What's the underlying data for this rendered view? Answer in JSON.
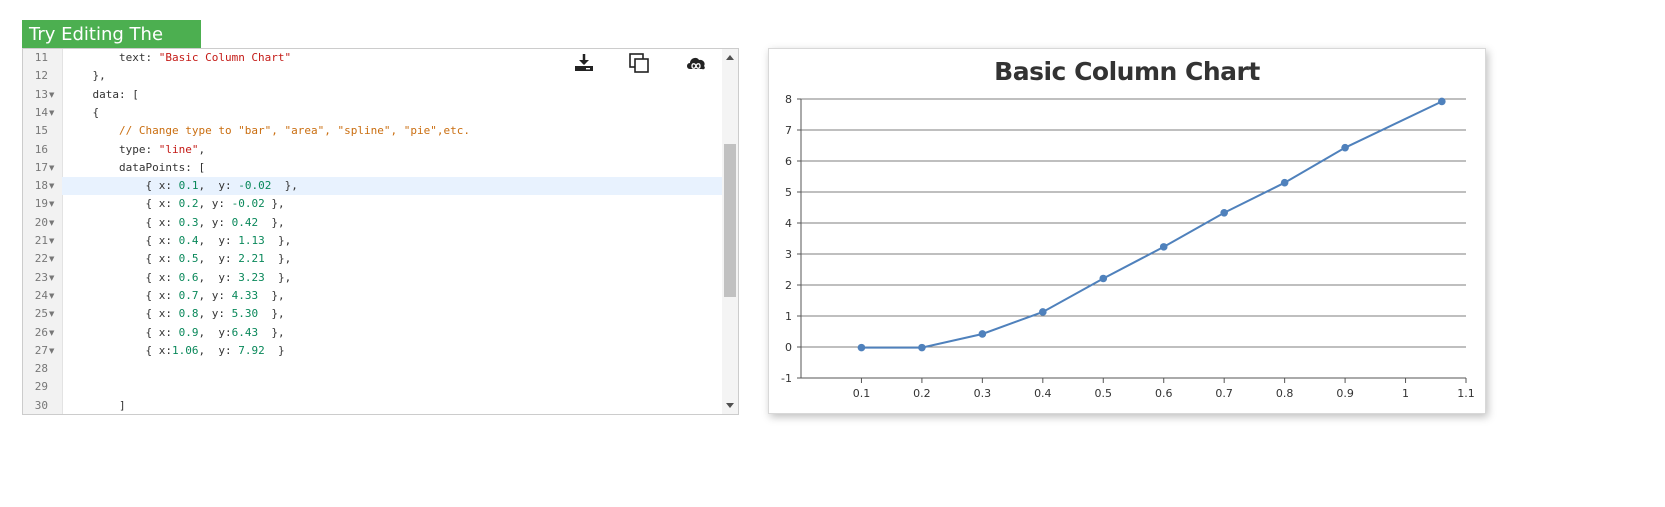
{
  "try_button": {
    "label": "Try Editing The Code"
  },
  "toolbar": {
    "icons": [
      "download-icon",
      "copy-icon",
      "cloud-infinity-icon"
    ]
  },
  "editor": {
    "lines": [
      {
        "num": "11",
        "fold": false,
        "active": false,
        "tokens": [
          {
            "t": "plain",
            "v": "        text: "
          },
          {
            "t": "str",
            "v": "\"Basic Column Chart\""
          }
        ]
      },
      {
        "num": "12",
        "fold": false,
        "active": false,
        "tokens": [
          {
            "t": "plain",
            "v": "    },"
          }
        ]
      },
      {
        "num": "13",
        "fold": true,
        "active": false,
        "tokens": [
          {
            "t": "plain",
            "v": "    data: ["
          }
        ]
      },
      {
        "num": "14",
        "fold": true,
        "active": false,
        "tokens": [
          {
            "t": "plain",
            "v": "    {"
          }
        ]
      },
      {
        "num": "15",
        "fold": false,
        "active": false,
        "tokens": [
          {
            "t": "com",
            "v": "        // Change type to \"bar\", \"area\", \"spline\", \"pie\",etc."
          }
        ]
      },
      {
        "num": "16",
        "fold": false,
        "active": false,
        "tokens": [
          {
            "t": "plain",
            "v": "        type: "
          },
          {
            "t": "str",
            "v": "\"line\""
          },
          {
            "t": "plain",
            "v": ","
          }
        ]
      },
      {
        "num": "17",
        "fold": true,
        "active": false,
        "tokens": [
          {
            "t": "plain",
            "v": "        dataPoints: ["
          }
        ]
      },
      {
        "num": "18",
        "fold": true,
        "active": true,
        "tokens": [
          {
            "t": "plain",
            "v": "            { x: "
          },
          {
            "t": "num",
            "v": "0.1"
          },
          {
            "t": "plain",
            "v": ",  y: "
          },
          {
            "t": "num",
            "v": "-0.02"
          },
          {
            "t": "plain",
            "v": "  },"
          }
        ]
      },
      {
        "num": "19",
        "fold": true,
        "active": false,
        "tokens": [
          {
            "t": "plain",
            "v": "            { x: "
          },
          {
            "t": "num",
            "v": "0.2"
          },
          {
            "t": "plain",
            "v": ", y: "
          },
          {
            "t": "num",
            "v": "-0.02"
          },
          {
            "t": "plain",
            "v": " },"
          }
        ]
      },
      {
        "num": "20",
        "fold": true,
        "active": false,
        "tokens": [
          {
            "t": "plain",
            "v": "            { x: "
          },
          {
            "t": "num",
            "v": "0.3"
          },
          {
            "t": "plain",
            "v": ", y: "
          },
          {
            "t": "num",
            "v": "0.42"
          },
          {
            "t": "plain",
            "v": "  },"
          }
        ]
      },
      {
        "num": "21",
        "fold": true,
        "active": false,
        "tokens": [
          {
            "t": "plain",
            "v": "            { x: "
          },
          {
            "t": "num",
            "v": "0.4"
          },
          {
            "t": "plain",
            "v": ",  y: "
          },
          {
            "t": "num",
            "v": "1.13"
          },
          {
            "t": "plain",
            "v": "  },"
          }
        ]
      },
      {
        "num": "22",
        "fold": true,
        "active": false,
        "tokens": [
          {
            "t": "plain",
            "v": "            { x: "
          },
          {
            "t": "num",
            "v": "0.5"
          },
          {
            "t": "plain",
            "v": ",  y: "
          },
          {
            "t": "num",
            "v": "2.21"
          },
          {
            "t": "plain",
            "v": "  },"
          }
        ]
      },
      {
        "num": "23",
        "fold": true,
        "active": false,
        "tokens": [
          {
            "t": "plain",
            "v": "            { x: "
          },
          {
            "t": "num",
            "v": "0.6"
          },
          {
            "t": "plain",
            "v": ",  y: "
          },
          {
            "t": "num",
            "v": "3.23"
          },
          {
            "t": "plain",
            "v": "  },"
          }
        ]
      },
      {
        "num": "24",
        "fold": true,
        "active": false,
        "tokens": [
          {
            "t": "plain",
            "v": "            { x: "
          },
          {
            "t": "num",
            "v": "0.7"
          },
          {
            "t": "plain",
            "v": ", y: "
          },
          {
            "t": "num",
            "v": "4.33"
          },
          {
            "t": "plain",
            "v": "  },"
          }
        ]
      },
      {
        "num": "25",
        "fold": true,
        "active": false,
        "tokens": [
          {
            "t": "plain",
            "v": "            { x: "
          },
          {
            "t": "num",
            "v": "0.8"
          },
          {
            "t": "plain",
            "v": ", y: "
          },
          {
            "t": "num",
            "v": "5.30"
          },
          {
            "t": "plain",
            "v": "  },"
          }
        ]
      },
      {
        "num": "26",
        "fold": true,
        "active": false,
        "tokens": [
          {
            "t": "plain",
            "v": "            { x: "
          },
          {
            "t": "num",
            "v": "0.9"
          },
          {
            "t": "plain",
            "v": ",  y:"
          },
          {
            "t": "num",
            "v": "6.43"
          },
          {
            "t": "plain",
            "v": "  },"
          }
        ]
      },
      {
        "num": "27",
        "fold": true,
        "active": false,
        "tokens": [
          {
            "t": "plain",
            "v": "            { x:"
          },
          {
            "t": "num",
            "v": "1.06"
          },
          {
            "t": "plain",
            "v": ",  y: "
          },
          {
            "t": "num",
            "v": "7.92"
          },
          {
            "t": "plain",
            "v": "  }"
          }
        ]
      },
      {
        "num": "28",
        "fold": false,
        "active": false,
        "tokens": []
      },
      {
        "num": "29",
        "fold": false,
        "active": false,
        "tokens": []
      },
      {
        "num": "30",
        "fold": false,
        "active": false,
        "tokens": [
          {
            "t": "plain",
            "v": "        ]"
          }
        ]
      }
    ]
  },
  "colors": {
    "accent_button": "#4caf50",
    "series_line": "#4f81bc",
    "string": "#c41a16",
    "number": "#09885a",
    "comment": "#ca6e10",
    "active_line": "#e8f2fe"
  },
  "chart_data": {
    "type": "line",
    "title": "Basic Column Chart",
    "xlabel": "",
    "ylabel": "",
    "ylim": [
      -1,
      8
    ],
    "xlim": [
      0,
      1.1
    ],
    "x_ticks": [
      "0.1",
      "0.2",
      "0.3",
      "0.4",
      "0.5",
      "0.6",
      "0.7",
      "0.8",
      "0.9",
      "1",
      "1.1"
    ],
    "x_tick_values": [
      0.1,
      0.2,
      0.3,
      0.4,
      0.5,
      0.6,
      0.7,
      0.8,
      0.9,
      1.0,
      1.1
    ],
    "y_ticks": [
      "-1",
      "0",
      "1",
      "2",
      "3",
      "4",
      "5",
      "6",
      "7",
      "8"
    ],
    "y_tick_values": [
      -1,
      0,
      1,
      2,
      3,
      4,
      5,
      6,
      7,
      8
    ],
    "grid": true,
    "series": [
      {
        "x": [
          0.1,
          0.2,
          0.3,
          0.4,
          0.5,
          0.6,
          0.7,
          0.8,
          0.9,
          1.06
        ],
        "y": [
          -0.02,
          -0.02,
          0.42,
          1.13,
          2.21,
          3.23,
          4.33,
          5.3,
          6.43,
          7.92
        ]
      }
    ]
  }
}
